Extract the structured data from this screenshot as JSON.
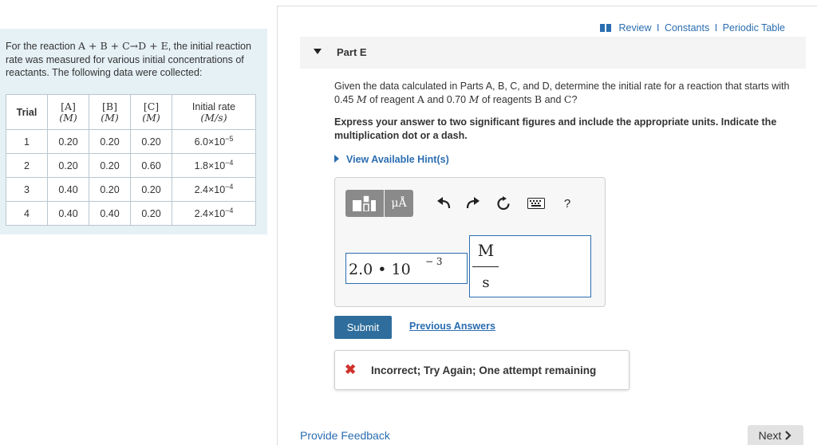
{
  "problem": {
    "intro_prefix": "For the reaction",
    "reaction": "A + B + C→D + E",
    "intro_suffix": ", the initial reaction rate was measured for various initial concentrations of reactants. The following data were collected:"
  },
  "table": {
    "headers": {
      "trial": "Trial",
      "a_top": "[A]",
      "a_bottom": "(M)",
      "b_top": "[B]",
      "b_bottom": "(M)",
      "c_top": "[C]",
      "c_bottom": "(M)",
      "rate_top": "Initial rate",
      "rate_bottom": "(M/s)"
    },
    "rows": [
      {
        "trial": "1",
        "a": "0.20",
        "b": "0.20",
        "c": "0.20",
        "rate_base": "6.0×10",
        "rate_exp": "−5"
      },
      {
        "trial": "2",
        "a": "0.20",
        "b": "0.20",
        "c": "0.60",
        "rate_base": "1.8×10",
        "rate_exp": "−4"
      },
      {
        "trial": "3",
        "a": "0.40",
        "b": "0.20",
        "c": "0.20",
        "rate_base": "2.4×10",
        "rate_exp": "−4"
      },
      {
        "trial": "4",
        "a": "0.40",
        "b": "0.40",
        "c": "0.20",
        "rate_base": "2.4×10",
        "rate_exp": "−4"
      }
    ]
  },
  "top_links": {
    "review": "Review",
    "constants": "Constants",
    "periodic_table": "Periodic Table",
    "separator": "I"
  },
  "part": {
    "title": "Part E"
  },
  "question": {
    "p1": "Given the data calculated in Parts A, B, C, and D, determine the initial rate for a reaction that starts with 0.45",
    "unit1": "M",
    "p2": "of reagent",
    "reagent_a": "A",
    "p3": "and 0.70",
    "unit2": "M",
    "p4": "of reagents",
    "reagent_b": "B",
    "p5": "and",
    "reagent_c": "C",
    "p6": "?"
  },
  "instruction": "Express your answer to two significant figures and include the appropriate units. Indicate the multiplication dot or a dash.",
  "hints_label": "View Available Hint(s)",
  "toolbar": {
    "units_label": "μÅ",
    "undo_icon": "undo-icon",
    "redo_icon": "redo-icon",
    "reset_icon": "reset-icon",
    "keyboard_icon": "keyboard-icon",
    "help_label": "?"
  },
  "answer": {
    "value_text": "2.0 • 10",
    "exponent": "− 3",
    "unit_numerator": "M",
    "unit_denominator": "s"
  },
  "submit_label": "Submit",
  "previous_answers_label": "Previous Answers",
  "feedback": {
    "text": "Incorrect; Try Again; One attempt remaining"
  },
  "footer": {
    "provide_feedback": "Provide Feedback",
    "next_label": "Next"
  },
  "colors": {
    "link": "#2a6db0",
    "panel_bg": "#e6f1f6",
    "error": "#d0322c",
    "submit_bg": "#2f6e9c"
  }
}
